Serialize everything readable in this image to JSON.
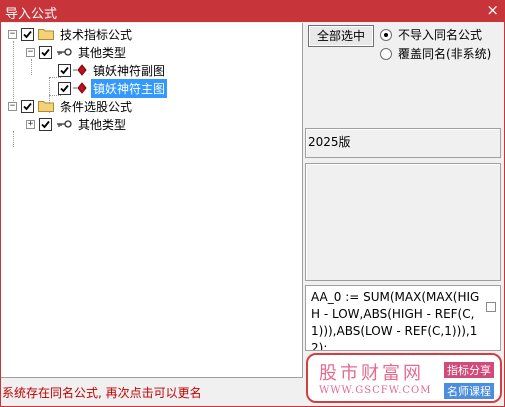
{
  "window": {
    "title": "导入公式",
    "close_glyph": "×"
  },
  "tree": {
    "nodes": [
      {
        "label": "技术指标公式",
        "expander": "−",
        "checked": true,
        "icon": "folder-icon"
      },
      {
        "label": "其他类型",
        "expander": "−",
        "checked": true,
        "icon": "key-icon"
      },
      {
        "label": "镇妖神符副图",
        "checked": true,
        "icon": "formula-icon"
      },
      {
        "label": "镇妖神符主图",
        "checked": true,
        "icon": "formula-icon",
        "selected": true
      },
      {
        "label": "条件选股公式",
        "expander": "−",
        "checked": true,
        "icon": "folder-icon"
      },
      {
        "label": "其他类型",
        "expander": "+",
        "checked": true,
        "icon": "key-icon"
      }
    ]
  },
  "actions": {
    "select_all_label": "全部选中",
    "options": [
      {
        "label": "不导入同名公式",
        "selected": true
      },
      {
        "label": "覆盖同名(非系统)",
        "selected": false
      }
    ]
  },
  "version_text": "2025版",
  "formula_text": "AA_0 := SUM(MAX(MAX(HIGH - LOW,ABS(HIGH - REF(C,1))),ABS(LOW - REF(C,1))),12);",
  "status_text": "系统存在同名公式, 再次点击可以更名",
  "watermark": {
    "site_name": "股市财富网",
    "url": "WWW.GSCFW.COM",
    "tag1": "指标分享",
    "tag2": "名师课程"
  },
  "colors": {
    "accent": "#c7353a",
    "selection": "#3399ff",
    "status": "#c00000"
  }
}
